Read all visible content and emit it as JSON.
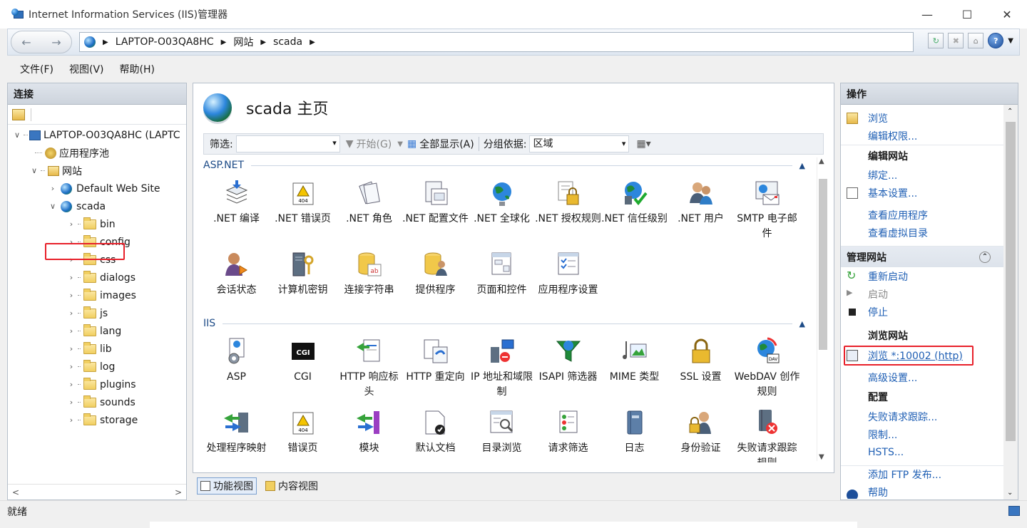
{
  "window": {
    "title": "Internet Information Services (IIS)管理器"
  },
  "breadcrumb": [
    "LAPTOP-O03QA8HC",
    "网站",
    "scada"
  ],
  "menu": [
    "文件(F)",
    "视图(V)",
    "帮助(H)"
  ],
  "connections": {
    "title": "连接",
    "server": "LAPTOP-O03QA8HC (LAPTC",
    "app_pools": "应用程序池",
    "sites": "网站",
    "default_site": "Default Web Site",
    "selected_site": "scada",
    "folders": [
      "bin",
      "config",
      "css",
      "dialogs",
      "images",
      "js",
      "lang",
      "lib",
      "log",
      "plugins",
      "sounds",
      "storage"
    ]
  },
  "center": {
    "title": "scada 主页",
    "filter_label": "筛选:",
    "start_label": "开始(G)",
    "show_all_label": "全部显示(A)",
    "group_by_label": "分组依据:",
    "group_by_value": "区域",
    "sections": [
      {
        "name": "ASP.NET",
        "items": [
          ".NET 编译",
          ".NET 错误页",
          ".NET 角色",
          ".NET 配置文件",
          ".NET 全球化",
          ".NET 授权规则",
          ".NET 信任级别",
          ".NET 用户",
          "SMTP 电子邮件",
          "会话状态",
          "计算机密钥",
          "连接字符串",
          "提供程序",
          "页面和控件",
          "应用程序设置"
        ]
      },
      {
        "name": "IIS",
        "items": [
          "ASP",
          "CGI",
          "HTTP 响应标头",
          "HTTP 重定向",
          "IP 地址和域限制",
          "ISAPI 筛选器",
          "MIME 类型",
          "SSL 设置",
          "WebDAV 创作规则",
          "处理程序映射",
          "错误页",
          "模块",
          "默认文档",
          "目录浏览",
          "请求筛选",
          "日志",
          "身份验证",
          "失败请求跟踪规则"
        ]
      }
    ],
    "view_tabs": [
      "功能视图",
      "内容视图"
    ]
  },
  "actions": {
    "title": "操作",
    "explore": "浏览",
    "edit_permissions": "编辑权限...",
    "edit_site_title": "编辑网站",
    "bindings": "绑定...",
    "basic_settings": "基本设置...",
    "view_apps": "查看应用程序",
    "view_vdirs": "查看虚拟目录",
    "manage_site_title": "管理网站",
    "restart": "重新启动",
    "start": "启动",
    "stop": "停止",
    "browse_site_title": "浏览网站",
    "browse_link": "浏览 *:10002 (http)",
    "advanced_settings": "高级设置...",
    "config_title": "配置",
    "failed_request_tracing": "失败请求跟踪...",
    "limits": "限制...",
    "hsts": "HSTS...",
    "add_ftp": "添加 FTP 发布...",
    "help": "帮助"
  },
  "status": {
    "text": "就绪"
  }
}
